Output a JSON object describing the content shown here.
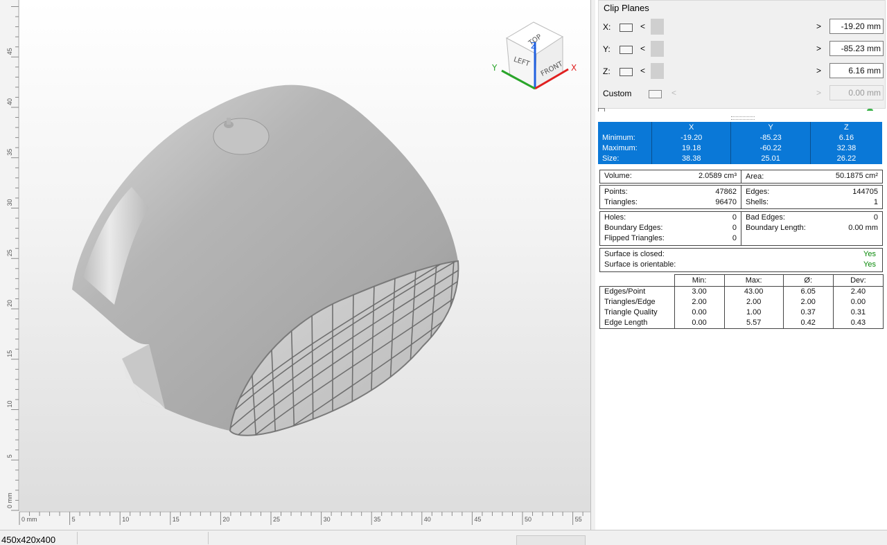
{
  "viewport": {
    "axis_unit": "mm",
    "vertical_ruler_labels": [
      "0 mm",
      "5",
      "10",
      "15",
      "20",
      "25",
      "30",
      "35",
      "40",
      "45"
    ],
    "horizontal_ruler_labels": [
      "0 mm",
      "5",
      "10",
      "15",
      "20",
      "25",
      "30",
      "35",
      "40",
      "45",
      "50",
      "55"
    ],
    "view_cube": {
      "top": "TOP",
      "left": "LEFT",
      "front": "FRONT",
      "axis_x": "X",
      "axis_y": "Y",
      "axis_z": "Z"
    }
  },
  "status": {
    "dimensions": "450x420x400"
  },
  "clip_planes": {
    "title": "Clip Planes",
    "prev_glyph": "<",
    "next_glyph": ">",
    "rows": [
      {
        "label": "X:",
        "value": "-19.20 mm"
      },
      {
        "label": "Y:",
        "value": "-85.23 mm"
      },
      {
        "label": "Z:",
        "value": "6.16 mm"
      },
      {
        "label": "Custom",
        "value": "0.00 mm"
      }
    ]
  },
  "bounds": {
    "headers": [
      "X",
      "Y",
      "Z"
    ],
    "rows": [
      {
        "label": "Minimum:",
        "x": "-19.20",
        "y": "-85.23",
        "z": "6.16"
      },
      {
        "label": "Maximum:",
        "x": "19.18",
        "y": "-60.22",
        "z": "32.38"
      },
      {
        "label": "Size:",
        "x": "38.38",
        "y": "25.01",
        "z": "26.22"
      }
    ]
  },
  "volume": {
    "label": "Volume:",
    "value": "2.0589 cm³",
    "area_label": "Area:",
    "area_value": "50.1875 cm²"
  },
  "mesh": {
    "points_label": "Points:",
    "points": "47862",
    "triangles_label": "Triangles:",
    "triangles": "96470",
    "edges_label": "Edges:",
    "edges": "144705",
    "shells_label": "Shells:",
    "shells": "1"
  },
  "errors": {
    "holes_label": "Holes:",
    "holes": "0",
    "boundary_edges_label": "Boundary Edges:",
    "boundary_edges": "0",
    "flipped_label": "Flipped Triangles:",
    "flipped": "0",
    "bad_edges_label": "Bad Edges:",
    "bad_edges": "0",
    "boundary_length_label": "Boundary Length:",
    "boundary_length": "0.00 mm"
  },
  "surface": {
    "closed_label": "Surface is closed:",
    "closed": "Yes",
    "orientable_label": "Surface is orientable:",
    "orientable": "Yes"
  },
  "quality": {
    "headers": [
      "Min:",
      "Max:",
      "Ø:",
      "Dev:"
    ],
    "rows": [
      {
        "label": "Edges/Point",
        "min": "3.00",
        "max": "43.00",
        "avg": "6.05",
        "dev": "2.40"
      },
      {
        "label": "Triangles/Edge",
        "min": "2.00",
        "max": "2.00",
        "avg": "2.00",
        "dev": "0.00"
      },
      {
        "label": "Triangle Quality",
        "min": "0.00",
        "max": "1.00",
        "avg": "0.37",
        "dev": "0.31"
      },
      {
        "label": "Edge Length",
        "min": "0.00",
        "max": "5.57",
        "avg": "0.42",
        "dev": "0.43"
      }
    ]
  },
  "colors": {
    "selection": "#0a78d7",
    "yes": "#0a8a0a",
    "axis_x": "#e02020",
    "axis_y": "#2aa52a",
    "axis_z": "#2060e0"
  }
}
